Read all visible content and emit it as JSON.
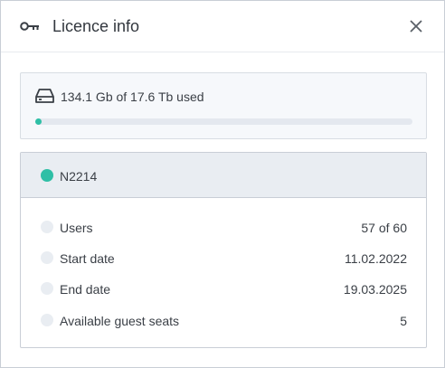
{
  "dialog": {
    "title": "Licence info",
    "icon": "key-icon",
    "close_icon": "close-icon"
  },
  "storage": {
    "icon": "hard-drive-icon",
    "text": "134.1 Gb of 17.6 Tb used",
    "used_fraction": 0.0074
  },
  "licence": {
    "name": "N2214",
    "status_color": "#2fbfa6",
    "rows": [
      {
        "label": "Users",
        "value": "57 of 60"
      },
      {
        "label": "Start date",
        "value": "11.02.2022"
      },
      {
        "label": "End date",
        "value": "19.03.2025"
      },
      {
        "label": "Available guest seats",
        "value": "5"
      }
    ]
  },
  "colors": {
    "accent": "#2fbfa6",
    "border": "#c9ced6",
    "panel_bg": "#f6f8fb",
    "header_bg": "#e9edf2"
  }
}
